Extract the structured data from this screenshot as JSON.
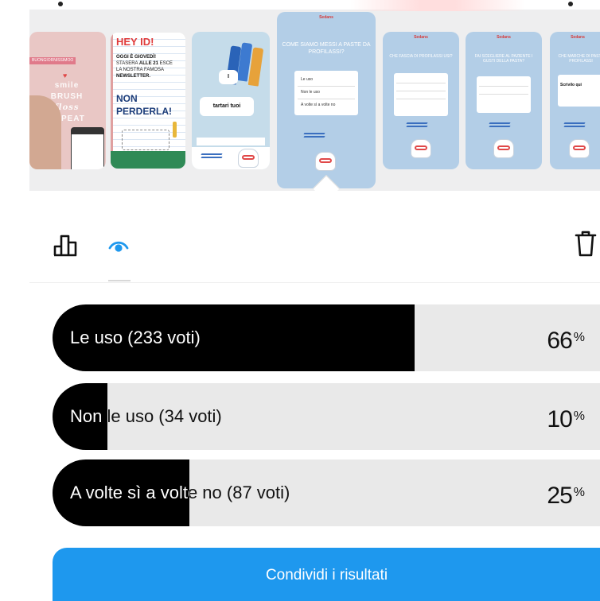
{
  "stories": {
    "thumb1": {
      "tag": "BUONGIORNISSIMOO",
      "words": [
        "smile",
        "BRUSH",
        "floss",
        "REPEAT"
      ]
    },
    "thumb2": {
      "title": "HEY ID!",
      "line1": "OGGI È GIOVEDÌ!",
      "line2_pre": "STASERA ",
      "line2_bold": "ALLE 21",
      "line2_post": " ESCE",
      "line3": "LA NOSTRA FAMOSA",
      "line4": "NEWSLETTER.",
      "big1": "NON",
      "big2": "PERDERLA!"
    },
    "thumb3": {
      "bubble1": "I",
      "bubble2": "tartari tuoi"
    },
    "thumb4": {
      "brand": "Sedans",
      "question": "COME SIAMO MESSI A PASTE DA PROFILASSI?",
      "options": [
        "Le uso",
        "Non le uso",
        "A volte sì a volte no"
      ],
      "logo": "GLOBE DENTAL"
    },
    "thumb5": {
      "question": "CHE FASCIA DI PROFILASSI USI?"
    },
    "thumb6": {
      "question": "FAI SCEGLIERE AL PAZIENTE I GUSTI DELLA PASTA?"
    },
    "thumb7": {
      "question": "CHE MARCHE DI PASTA PROFILASSI",
      "input": "Scrivilo qui"
    }
  },
  "toolbar": {
    "insights_icon": "bar-chart-icon",
    "viewers_icon": "eye-icon",
    "delete_icon": "trash-icon",
    "accent": "#1e98ee"
  },
  "poll": {
    "results": [
      {
        "label": "Le uso (233 voti)",
        "percent_text": "66",
        "percent_sign": "%",
        "fraction": 0.66
      },
      {
        "label": "Non le uso (34 voti)",
        "percent_text": "10",
        "percent_sign": "%",
        "fraction": 0.1
      },
      {
        "label": "A volte sì a volte no (87 voti)",
        "percent_text": "25",
        "percent_sign": "%",
        "fraction": 0.25
      }
    ]
  },
  "share_button": {
    "label": "Condividi i risultati",
    "color": "#1e98ee"
  }
}
